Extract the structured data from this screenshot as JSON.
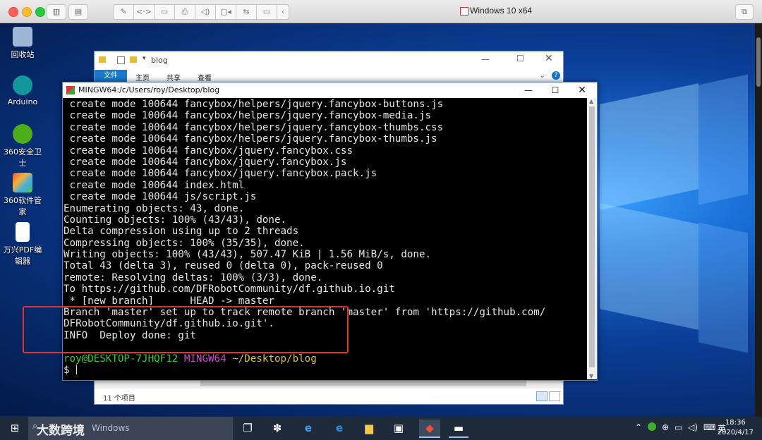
{
  "vm": {
    "title": "Windows 10 x64",
    "toolbar_icons": [
      "sidebar-icon",
      "snapshot-icon",
      "wrench-icon",
      "code-icon",
      "drive-icon",
      "printer-icon",
      "audio-icon",
      "camera-icon",
      "usb-icon",
      "shared-folder-icon",
      "chevron-left-icon",
      "fullscreen-icon"
    ]
  },
  "desktop": {
    "icons": [
      {
        "label": "回收站",
        "icon": "recycle-bin-icon",
        "color": "#9fb7d6"
      },
      {
        "label": "Arduino",
        "icon": "arduino-icon",
        "color": "#11979c"
      },
      {
        "label": "360安全卫士",
        "icon": "360-security-icon",
        "color": "#4caf1a"
      },
      {
        "label": "360软件管家",
        "icon": "360-software-icon",
        "color": "#e8543c"
      },
      {
        "label": "万兴PDF编辑器",
        "icon": "pdf-editor-icon",
        "color": "#ffffff"
      }
    ]
  },
  "explorer": {
    "title": "blog",
    "tabs": [
      "文件",
      "主页",
      "共享",
      "查看"
    ],
    "status": "11 个项目",
    "accent": "#1979ca"
  },
  "terminal": {
    "title": "MINGW64:/c/Users/roy/Desktop/blog",
    "lines": [
      " create mode 100644 fancybox/helpers/jquery.fancybox-buttons.js",
      " create mode 100644 fancybox/helpers/jquery.fancybox-media.js",
      " create mode 100644 fancybox/helpers/jquery.fancybox-thumbs.css",
      " create mode 100644 fancybox/helpers/jquery.fancybox-thumbs.js",
      " create mode 100644 fancybox/jquery.fancybox.css",
      " create mode 100644 fancybox/jquery.fancybox.js",
      " create mode 100644 fancybox/jquery.fancybox.pack.js",
      " create mode 100644 index.html",
      " create mode 100644 js/script.js",
      "Enumerating objects: 43, done.",
      "Counting objects: 100% (43/43), done.",
      "Delta compression using up to 2 threads",
      "Compressing objects: 100% (35/35), done.",
      "Writing objects: 100% (43/43), 507.47 KiB | 1.56 MiB/s, done.",
      "Total 43 (delta 3), reused 0 (delta 0), pack-reused 0",
      "remote: Resolving deltas: 100% (3/3), done.",
      "To https://github.com/DFRobotCommunity/df.github.io.git",
      " * [new branch]      HEAD -> master",
      "Branch 'master' set up to track remote branch 'master' from 'https://github.com/",
      "DFRobotCommunity/df.github.io.git'.",
      "INFO  Deploy done: git",
      ""
    ],
    "prompt_user": "roy@DESKTOP-7JHQF12",
    "prompt_env": "MINGW64",
    "prompt_path": "~/Desktop/blog",
    "prompt_symbol": "$",
    "colors": {
      "user": "#2fd12f",
      "env": "#c94fc9",
      "path": "#d7c24a",
      "highlight": "#e0332f"
    }
  },
  "taskbar": {
    "search_placeholder": "Windows",
    "watermark": "大数跨境",
    "apps": [
      "task-view-icon",
      "pinwheel-icon",
      "ie-icon",
      "edge-icon",
      "file-explorer-icon",
      "store-icon",
      "git-icon",
      "terminal-icon"
    ],
    "tray_lang": "英",
    "time": "18:36",
    "date": "2020/4/17"
  }
}
